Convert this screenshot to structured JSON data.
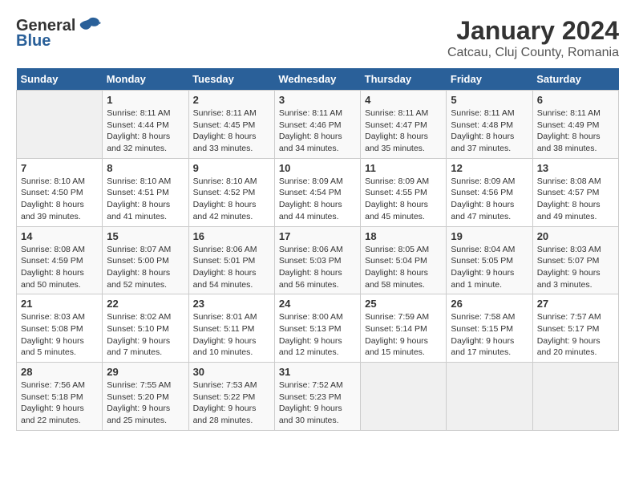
{
  "logo": {
    "general": "General",
    "blue": "Blue"
  },
  "title": "January 2024",
  "subtitle": "Catcau, Cluj County, Romania",
  "days_header": [
    "Sunday",
    "Monday",
    "Tuesday",
    "Wednesday",
    "Thursday",
    "Friday",
    "Saturday"
  ],
  "weeks": [
    [
      {
        "day": "",
        "sunrise": "",
        "sunset": "",
        "daylight": ""
      },
      {
        "day": "1",
        "sunrise": "Sunrise: 8:11 AM",
        "sunset": "Sunset: 4:44 PM",
        "daylight": "Daylight: 8 hours and 32 minutes."
      },
      {
        "day": "2",
        "sunrise": "Sunrise: 8:11 AM",
        "sunset": "Sunset: 4:45 PM",
        "daylight": "Daylight: 8 hours and 33 minutes."
      },
      {
        "day": "3",
        "sunrise": "Sunrise: 8:11 AM",
        "sunset": "Sunset: 4:46 PM",
        "daylight": "Daylight: 8 hours and 34 minutes."
      },
      {
        "day": "4",
        "sunrise": "Sunrise: 8:11 AM",
        "sunset": "Sunset: 4:47 PM",
        "daylight": "Daylight: 8 hours and 35 minutes."
      },
      {
        "day": "5",
        "sunrise": "Sunrise: 8:11 AM",
        "sunset": "Sunset: 4:48 PM",
        "daylight": "Daylight: 8 hours and 37 minutes."
      },
      {
        "day": "6",
        "sunrise": "Sunrise: 8:11 AM",
        "sunset": "Sunset: 4:49 PM",
        "daylight": "Daylight: 8 hours and 38 minutes."
      }
    ],
    [
      {
        "day": "7",
        "sunrise": "Sunrise: 8:10 AM",
        "sunset": "Sunset: 4:50 PM",
        "daylight": "Daylight: 8 hours and 39 minutes."
      },
      {
        "day": "8",
        "sunrise": "Sunrise: 8:10 AM",
        "sunset": "Sunset: 4:51 PM",
        "daylight": "Daylight: 8 hours and 41 minutes."
      },
      {
        "day": "9",
        "sunrise": "Sunrise: 8:10 AM",
        "sunset": "Sunset: 4:52 PM",
        "daylight": "Daylight: 8 hours and 42 minutes."
      },
      {
        "day": "10",
        "sunrise": "Sunrise: 8:09 AM",
        "sunset": "Sunset: 4:54 PM",
        "daylight": "Daylight: 8 hours and 44 minutes."
      },
      {
        "day": "11",
        "sunrise": "Sunrise: 8:09 AM",
        "sunset": "Sunset: 4:55 PM",
        "daylight": "Daylight: 8 hours and 45 minutes."
      },
      {
        "day": "12",
        "sunrise": "Sunrise: 8:09 AM",
        "sunset": "Sunset: 4:56 PM",
        "daylight": "Daylight: 8 hours and 47 minutes."
      },
      {
        "day": "13",
        "sunrise": "Sunrise: 8:08 AM",
        "sunset": "Sunset: 4:57 PM",
        "daylight": "Daylight: 8 hours and 49 minutes."
      }
    ],
    [
      {
        "day": "14",
        "sunrise": "Sunrise: 8:08 AM",
        "sunset": "Sunset: 4:59 PM",
        "daylight": "Daylight: 8 hours and 50 minutes."
      },
      {
        "day": "15",
        "sunrise": "Sunrise: 8:07 AM",
        "sunset": "Sunset: 5:00 PM",
        "daylight": "Daylight: 8 hours and 52 minutes."
      },
      {
        "day": "16",
        "sunrise": "Sunrise: 8:06 AM",
        "sunset": "Sunset: 5:01 PM",
        "daylight": "Daylight: 8 hours and 54 minutes."
      },
      {
        "day": "17",
        "sunrise": "Sunrise: 8:06 AM",
        "sunset": "Sunset: 5:03 PM",
        "daylight": "Daylight: 8 hours and 56 minutes."
      },
      {
        "day": "18",
        "sunrise": "Sunrise: 8:05 AM",
        "sunset": "Sunset: 5:04 PM",
        "daylight": "Daylight: 8 hours and 58 minutes."
      },
      {
        "day": "19",
        "sunrise": "Sunrise: 8:04 AM",
        "sunset": "Sunset: 5:05 PM",
        "daylight": "Daylight: 9 hours and 1 minute."
      },
      {
        "day": "20",
        "sunrise": "Sunrise: 8:03 AM",
        "sunset": "Sunset: 5:07 PM",
        "daylight": "Daylight: 9 hours and 3 minutes."
      }
    ],
    [
      {
        "day": "21",
        "sunrise": "Sunrise: 8:03 AM",
        "sunset": "Sunset: 5:08 PM",
        "daylight": "Daylight: 9 hours and 5 minutes."
      },
      {
        "day": "22",
        "sunrise": "Sunrise: 8:02 AM",
        "sunset": "Sunset: 5:10 PM",
        "daylight": "Daylight: 9 hours and 7 minutes."
      },
      {
        "day": "23",
        "sunrise": "Sunrise: 8:01 AM",
        "sunset": "Sunset: 5:11 PM",
        "daylight": "Daylight: 9 hours and 10 minutes."
      },
      {
        "day": "24",
        "sunrise": "Sunrise: 8:00 AM",
        "sunset": "Sunset: 5:13 PM",
        "daylight": "Daylight: 9 hours and 12 minutes."
      },
      {
        "day": "25",
        "sunrise": "Sunrise: 7:59 AM",
        "sunset": "Sunset: 5:14 PM",
        "daylight": "Daylight: 9 hours and 15 minutes."
      },
      {
        "day": "26",
        "sunrise": "Sunrise: 7:58 AM",
        "sunset": "Sunset: 5:15 PM",
        "daylight": "Daylight: 9 hours and 17 minutes."
      },
      {
        "day": "27",
        "sunrise": "Sunrise: 7:57 AM",
        "sunset": "Sunset: 5:17 PM",
        "daylight": "Daylight: 9 hours and 20 minutes."
      }
    ],
    [
      {
        "day": "28",
        "sunrise": "Sunrise: 7:56 AM",
        "sunset": "Sunset: 5:18 PM",
        "daylight": "Daylight: 9 hours and 22 minutes."
      },
      {
        "day": "29",
        "sunrise": "Sunrise: 7:55 AM",
        "sunset": "Sunset: 5:20 PM",
        "daylight": "Daylight: 9 hours and 25 minutes."
      },
      {
        "day": "30",
        "sunrise": "Sunrise: 7:53 AM",
        "sunset": "Sunset: 5:22 PM",
        "daylight": "Daylight: 9 hours and 28 minutes."
      },
      {
        "day": "31",
        "sunrise": "Sunrise: 7:52 AM",
        "sunset": "Sunset: 5:23 PM",
        "daylight": "Daylight: 9 hours and 30 minutes."
      },
      {
        "day": "",
        "sunrise": "",
        "sunset": "",
        "daylight": ""
      },
      {
        "day": "",
        "sunrise": "",
        "sunset": "",
        "daylight": ""
      },
      {
        "day": "",
        "sunrise": "",
        "sunset": "",
        "daylight": ""
      }
    ]
  ]
}
